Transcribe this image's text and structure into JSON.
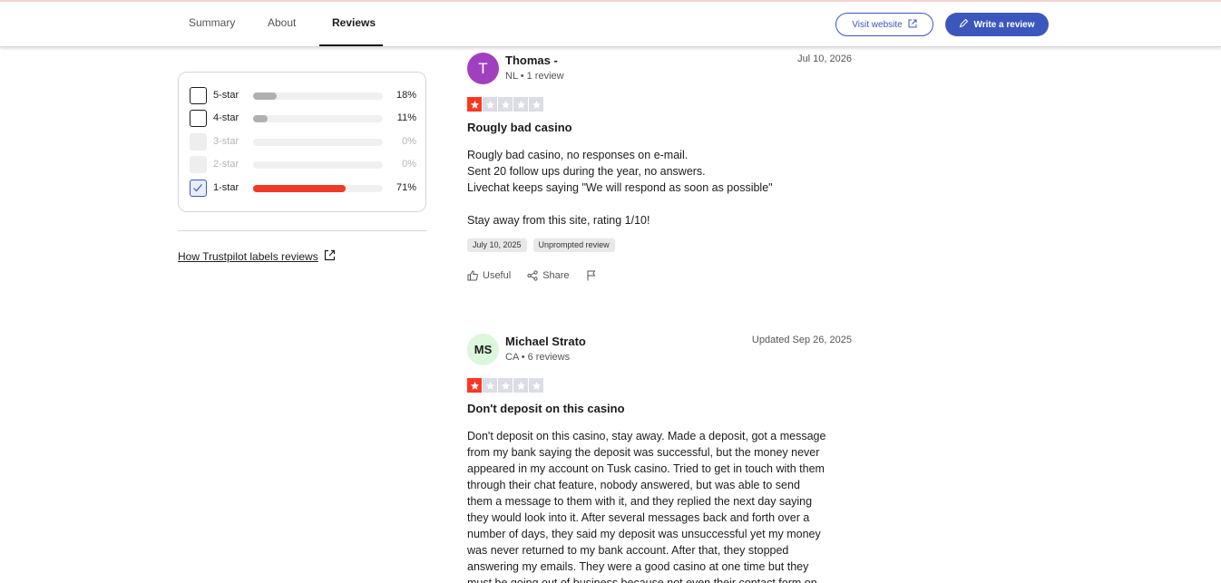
{
  "nav": {
    "tabs": [
      {
        "label": "Summary"
      },
      {
        "label": "About"
      },
      {
        "label": "Reviews"
      }
    ],
    "visit_label": "Visit website",
    "write_label": "Write a review"
  },
  "filters": {
    "rows": [
      {
        "label": "5-star",
        "percent_text": "18%",
        "percent": 18,
        "state": "unchecked"
      },
      {
        "label": "4-star",
        "percent_text": "11%",
        "percent": 11,
        "state": "unchecked"
      },
      {
        "label": "3-star",
        "percent_text": "0%",
        "percent": 0,
        "state": "disabled"
      },
      {
        "label": "2-star",
        "percent_text": "0%",
        "percent": 0,
        "state": "disabled"
      },
      {
        "label": "1-star",
        "percent_text": "71%",
        "percent": 71,
        "state": "checked"
      }
    ],
    "how_link": "How Trustpilot labels reviews"
  },
  "reviews": [
    {
      "avatar_text": "T",
      "avatar_bg": "#a040c0",
      "avatar_fg": "#ffffff",
      "name": "Thomas -",
      "meta": "NL • 1 review",
      "date": "Jul 10, 2026",
      "rating": 1,
      "title": "Rougly bad casino",
      "body_lines": [
        "Rougly bad casino, no responses on e-mail.",
        "Sent 20 follow ups during the year, no answers.",
        "Livechat keeps saying \"We will respond as soon as possible\"",
        "",
        "Stay away from this site, rating 1/10!"
      ],
      "tags": [
        "July 10, 2025",
        "Unprompted review"
      ],
      "useful": "Useful",
      "share": "Share"
    },
    {
      "avatar_text": "MS",
      "avatar_bg": "#dcf7dc",
      "avatar_fg": "#1c1c1c",
      "name": "Michael Strato",
      "meta": "CA • 6 reviews",
      "date": "Updated Sep 26, 2025",
      "rating": 1,
      "title": "Don't deposit on this casino",
      "body_lines": [
        "Don't deposit on this casino, stay away. Made a deposit, got a message",
        "from my bank saying the deposit was successful, but the money never",
        "appeared in my account on Tusk casino. Tried to get in touch with them",
        "through their chat feature, nobody answered, but was able to send",
        "them a message to them with it, and they replied the next day saying",
        "they would look into it. After several messages back and forth over a",
        "number of days, they said my deposit was unsuccessful yet my money",
        "was never returned to my bank account. After that, they stopped",
        "answering my emails. They were a good casino at one time but they",
        "must be going out of business because not even their contact form on"
      ]
    }
  ],
  "colors": {
    "accent": "#3c57bc",
    "star_red": "#ff3722",
    "one_star_bar": "#ee3a26",
    "bar_grey": "#b0b0b0"
  }
}
